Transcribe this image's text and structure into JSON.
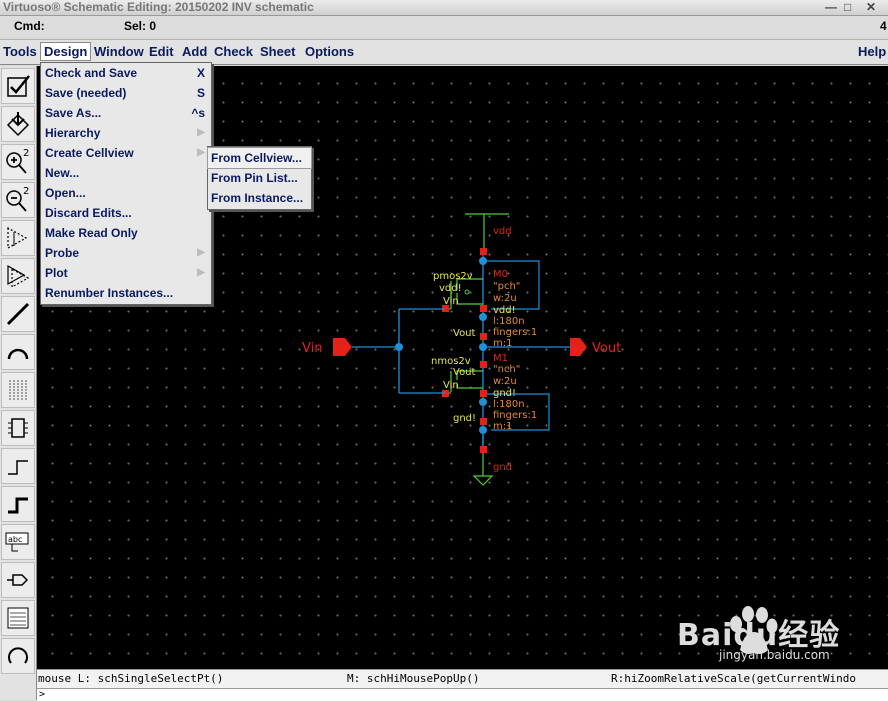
{
  "window": {
    "title": "Virtuoso® Schematic Editing: 20150202 INV schematic",
    "right_buttons": [
      "—",
      "□",
      "✕"
    ]
  },
  "status": {
    "cmd_label": "Cmd:",
    "sel_label": "Sel: 0",
    "number": "4"
  },
  "menubar": {
    "items": [
      "Tools",
      "Design",
      "Window",
      "Edit",
      "Add",
      "Check",
      "Sheet",
      "Options"
    ],
    "help": "Help"
  },
  "design_menu": {
    "items": [
      {
        "label": "Check and Save",
        "shortcut": "X"
      },
      {
        "label": "Save (needed)",
        "shortcut": "S"
      },
      {
        "label": "Save As...",
        "shortcut": "^s"
      },
      {
        "label": "Hierarchy",
        "submenu": true
      },
      {
        "label": "Create Cellview",
        "submenu": true
      },
      {
        "label": "New..."
      },
      {
        "label": "Open..."
      },
      {
        "label": "Discard Edits..."
      },
      {
        "label": "Make Read Only"
      },
      {
        "label": "Probe",
        "submenu": true
      },
      {
        "label": "Plot",
        "submenu": true
      },
      {
        "label": "Renumber Instances..."
      }
    ]
  },
  "create_cellview_submenu": {
    "items": [
      "From Cellview...",
      "From Pin List...",
      "From Instance..."
    ]
  },
  "toolbar": {
    "icons": [
      "check-icon",
      "save-icon",
      "zoom-in-icon",
      "zoom-out-icon",
      "stretch-icon",
      "copy-icon",
      "wire-icon",
      "arc-icon",
      "bus-icon",
      "instance-icon",
      "wire-narrow-icon",
      "wire-wide-icon",
      "label-icon",
      "pin-icon",
      "pan-icon",
      "undo-icon"
    ],
    "zoom_in_label": "2",
    "zoom_out_label": "2",
    "label_icon_text": "abc"
  },
  "schematic": {
    "pins": {
      "input": "Vin",
      "output": "Vout"
    },
    "supply": {
      "vdd": "vdd",
      "gnd": "gnd"
    },
    "pmos": {
      "model": "pmos2v",
      "body": "vdd!",
      "gate": "Vin",
      "drain": "Vout",
      "name": "M0",
      "params": [
        "\"pch\"",
        "w:2u",
        "l:180n",
        "fingers:1",
        "m:1"
      ],
      "terminal_label": "vdd!"
    },
    "nmos": {
      "model": "nmos2v",
      "body": "Vout",
      "gate": "Vin",
      "source": "gnd!",
      "name": "M1",
      "params": [
        "\"nch\"",
        "w:2u",
        "l:180n",
        "fingers:1",
        "m:1"
      ],
      "terminal_label": "gnd!"
    }
  },
  "prompt": {
    "left": "mouse L: schSingleSelectPt()",
    "middle": "M: schHiMousePopUp()",
    "right": "R:hiZoomRelativeScale(getCurrentWindo"
  },
  "cmdline": ">",
  "watermark": {
    "text": "Baidu经验",
    "url": "jingyan.baidu.com"
  },
  "colors": {
    "canvas": "#000000",
    "wire": "#1f8fd6",
    "pin": "#e8201a",
    "device": "#4fcc3a",
    "label": "#e6e64a",
    "param": "#e08a3a",
    "menu_text": "#0a1a60"
  }
}
